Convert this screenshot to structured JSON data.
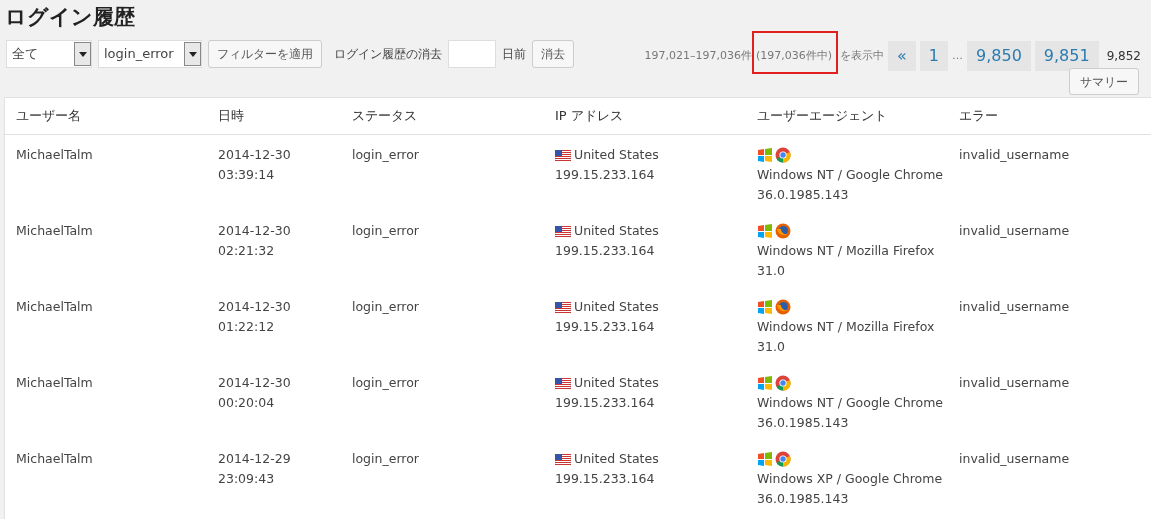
{
  "title": "ログイン履歴",
  "filters": {
    "user_select": "全て",
    "status_select": "login_error",
    "apply_button": "フィルターを適用",
    "purge_label": "ログイン履歴の消去",
    "purge_unit": "日前",
    "purge_button": "消去"
  },
  "pagination": {
    "range": "197,021–197,036件",
    "total": "(197,036件中)",
    "suffix": "を表示中",
    "highlighted": true,
    "pages": [
      {
        "label": "«",
        "kind": "link"
      },
      {
        "label": "1",
        "kind": "link"
      },
      {
        "label": "…",
        "kind": "gap"
      },
      {
        "label": "9,850",
        "kind": "link"
      },
      {
        "label": "9,851",
        "kind": "link"
      },
      {
        "label": "9,852",
        "kind": "current"
      }
    ]
  },
  "summary_button": "サマリー",
  "table": {
    "columns": [
      "ユーザー名",
      "日時",
      "ステータス",
      "IP アドレス",
      "ユーザーエージェント",
      "エラー"
    ],
    "rows": [
      {
        "user": "MichaelTalm",
        "date": "2014-12-30",
        "time": "03:39:14",
        "status": "login_error",
        "country": "United States",
        "ip": "199.15.233.164",
        "kind": "chrome",
        "agent": "Windows NT / Google Chrome",
        "version": "36.0.1985.143",
        "error": "invalid_username"
      },
      {
        "user": "MichaelTalm",
        "date": "2014-12-30",
        "time": "02:21:32",
        "status": "login_error",
        "country": "United States",
        "ip": "199.15.233.164",
        "kind": "firefox",
        "agent": "Windows NT / Mozilla Firefox",
        "version": "31.0",
        "error": "invalid_username"
      },
      {
        "user": "MichaelTalm",
        "date": "2014-12-30",
        "time": "01:22:12",
        "status": "login_error",
        "country": "United States",
        "ip": "199.15.233.164",
        "kind": "firefox",
        "agent": "Windows NT / Mozilla Firefox",
        "version": "31.0",
        "error": "invalid_username"
      },
      {
        "user": "MichaelTalm",
        "date": "2014-12-30",
        "time": "00:20:04",
        "status": "login_error",
        "country": "United States",
        "ip": "199.15.233.164",
        "kind": "chrome",
        "agent": "Windows NT / Google Chrome",
        "version": "36.0.1985.143",
        "error": "invalid_username"
      },
      {
        "user": "MichaelTalm",
        "date": "2014-12-29",
        "time": "23:09:43",
        "status": "login_error",
        "country": "United States",
        "ip": "199.15.233.164",
        "kind": "chrome",
        "agent": "Windows XP / Google Chrome",
        "version": "36.0.1985.143",
        "error": "invalid_username"
      }
    ]
  }
}
